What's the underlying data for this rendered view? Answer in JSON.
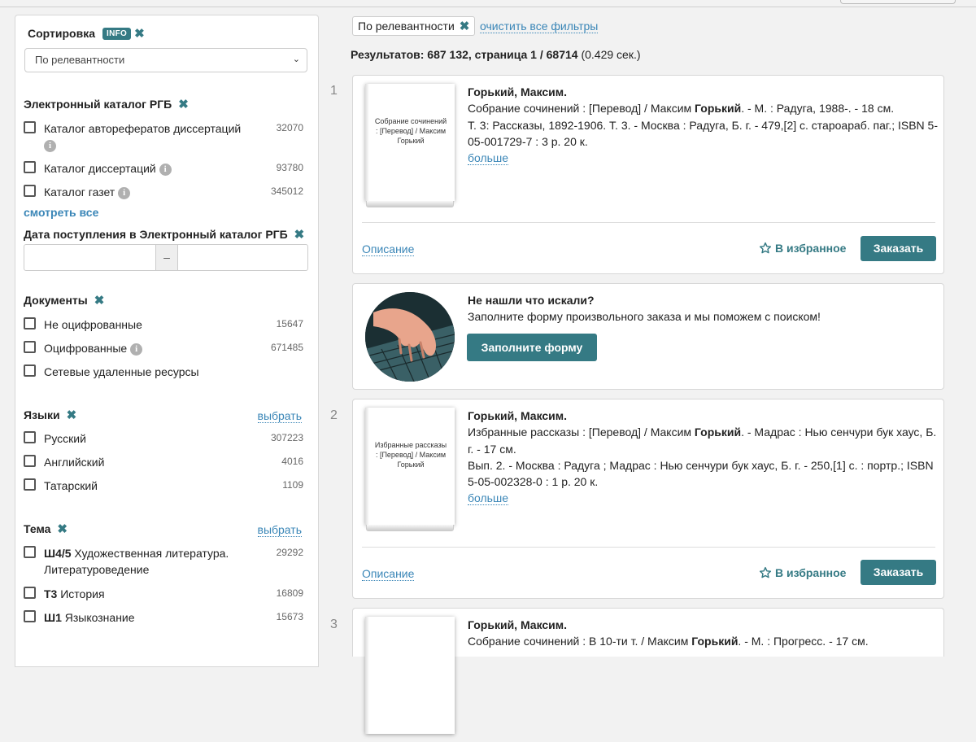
{
  "sidebar": {
    "sort": {
      "title": "Сортировка",
      "info_badge": "INFO",
      "selected": "По релевантности"
    },
    "catalog": {
      "title": "Электронный каталог РГБ",
      "items": [
        {
          "label": "Каталог авторефератов диссертаций",
          "count": "32070"
        },
        {
          "label": "Каталог диссертаций",
          "count": "93780"
        },
        {
          "label": "Каталог газет",
          "count": "345012"
        }
      ],
      "see_all": "смотреть все"
    },
    "date": {
      "title": "Дата поступления в Электронный каталог РГБ",
      "separator": "–"
    },
    "documents": {
      "title": "Документы",
      "items": [
        {
          "label": "Не оцифрованные",
          "count": "15647"
        },
        {
          "label": "Оцифрованные",
          "count": "671485"
        },
        {
          "label": "Сетевые удаленные ресурсы",
          "count": ""
        }
      ]
    },
    "languages": {
      "title": "Языки",
      "select_link": "выбрать",
      "items": [
        {
          "label": "Русский",
          "count": "307223"
        },
        {
          "label": "Английский",
          "count": "4016"
        },
        {
          "label": "Татарский",
          "count": "1109"
        }
      ]
    },
    "topics": {
      "title": "Тема",
      "select_link": "выбрать",
      "items": [
        {
          "code": "Ш4/5",
          "label": "Художественная литература. Литературоведение",
          "count": "29292"
        },
        {
          "code": "Т3",
          "label": "История",
          "count": "16809"
        },
        {
          "code": "Ш1",
          "label": "Языкознание",
          "count": "15673"
        }
      ]
    }
  },
  "main": {
    "active_filter": "По релевантности",
    "clear_filters": "очистить все фильтры",
    "results": {
      "prefix": "Результатов: 687 132, страница 1",
      "pages": " / 68714",
      "time": " (0.429 сек.)"
    },
    "records": [
      {
        "num": "1",
        "cover_title": "Собрание сочинений : [Перевод] / Максим Горький",
        "author": "Горький, Максим.",
        "line1_a": "Собрание сочинений : [Перевод] / Максим ",
        "line1_b": "Горький",
        "line1_c": ". - М. : Радуга, 1988-. - 18 см.",
        "line2": "Т. 3: Рассказы, 1892-1906. Т. 3. - Москва : Радуга, Б. г. - 479,[2] с. староараб. паг.; ISBN 5-05-001729-7 : 3 р. 20 к.",
        "more": "больше",
        "desc": "Описание",
        "fav": "В избранное",
        "order": "Заказать"
      },
      {
        "num": "2",
        "cover_title": "Избранные рассказы : [Перевод] / Максим Горький",
        "author": "Горький, Максим.",
        "line1_a": "Избранные рассказы : [Перевод] / Максим ",
        "line1_b": "Горький",
        "line1_c": ". - Мадрас : Нью сенчури бук хаус, Б. г. - 17 см.",
        "line2": "Вып. 2. - Москва : Радуга ; Мадрас : Нью сенчури бук хаус, Б. г. - 250,[1] с. : портр.; ISBN 5-05-002328-0 : 1 р. 20 к.",
        "more": "больше",
        "desc": "Описание",
        "fav": "В избранное",
        "order": "Заказать"
      },
      {
        "num": "3",
        "author": "Горький, Максим.",
        "line1_a": "Собрание сочинений : В 10-ти т. / Максим ",
        "line1_b": "Горький",
        "line1_c": ". - М. : Прогресс. - 17 см."
      }
    ],
    "promo": {
      "title": "Не нашли что искали?",
      "text": "Заполните форму произвольного заказа и мы поможем с поиском!",
      "button": "Заполните форму"
    }
  }
}
